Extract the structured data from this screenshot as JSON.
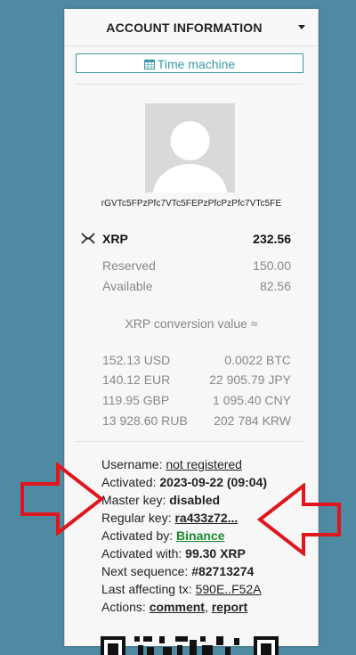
{
  "header": {
    "title": "ACCOUNT INFORMATION"
  },
  "time_machine": {
    "label": "Time machine",
    "icon": "calendar-icon"
  },
  "account": {
    "address": "rGVTc5FPzPfc7VTc5FEPzPfcPzPfc7VTc5FE"
  },
  "balance": {
    "currency": "XRP",
    "total": "232.56",
    "reserved_label": "Reserved",
    "reserved": "150.00",
    "available_label": "Available",
    "available": "82.56"
  },
  "conversion": {
    "title": "XRP conversion value ≈",
    "rows": [
      {
        "left": "152.13 USD",
        "right": "0.0022 BTC"
      },
      {
        "left": "140.12 EUR",
        "right": "22 905.79 JPY"
      },
      {
        "left": "119.95 GBP",
        "right": "1 095.40 CNY"
      },
      {
        "left": "13 928.60 RUB",
        "right": "202 784 KRW"
      }
    ]
  },
  "details": {
    "username_label": "Username:",
    "username_value": "not registered",
    "activated_label": "Activated:",
    "activated_value": "2023-09-22 (09:04)",
    "master_key_label": "Master key:",
    "master_key_value": "disabled",
    "regular_key_label": "Regular key:",
    "regular_key_value": "ra433z72...",
    "activated_by_label": "Activated by:",
    "activated_by_value": "Binance",
    "activated_with_label": "Activated with:",
    "activated_with_value": "99.30 XRP",
    "next_sequence_label": "Next sequence:",
    "next_sequence_value": "#82713274",
    "last_tx_label": "Last affecting tx:",
    "last_tx_value": "590E..F52A",
    "actions_label": "Actions:",
    "action_comment": "comment",
    "action_report": "report"
  },
  "colors": {
    "background": "#4f8aa3",
    "accent": "#3a9aa5",
    "annotation_arrow": "#e0161e",
    "link_green": "#1d8a2e"
  }
}
